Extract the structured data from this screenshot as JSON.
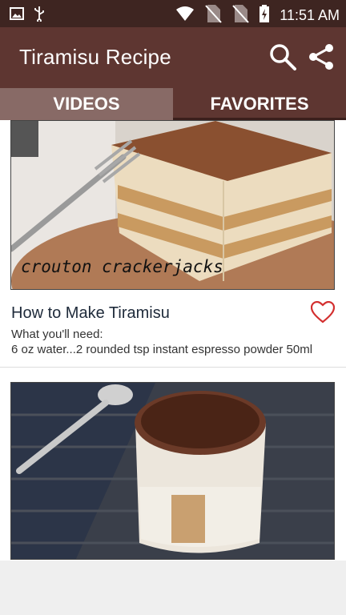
{
  "status_bar": {
    "time": "11:51 AM",
    "icons": [
      "image-icon",
      "usb-icon",
      "wifi-icon",
      "no-sim-icon",
      "no-sim-icon",
      "battery-charging-icon"
    ]
  },
  "app_bar": {
    "title": "Tiramisu Recipe",
    "actions": [
      "search-icon",
      "share-icon"
    ]
  },
  "tabs": [
    {
      "label": "VIDEOS",
      "selected": false
    },
    {
      "label": "FAVORITES",
      "selected": true
    }
  ],
  "cards": [
    {
      "image_caption": "crouton crackerjacks",
      "title": "How to Make Tiramisu",
      "description_line1": "What you'll need:",
      "description_line2": "6 oz water...2 rounded tsp instant espresso powder  50ml",
      "favorite_icon": "heart-outline-icon"
    },
    {
      "image_caption": "",
      "title": "",
      "description_line1": "",
      "description_line2": ""
    }
  ],
  "colors": {
    "status_bar": "#3e2521",
    "app_bar": "#5e3631",
    "tab_unselected": "#886a66",
    "tab_selected": "#5e3631",
    "heart": "#d32f2f"
  }
}
